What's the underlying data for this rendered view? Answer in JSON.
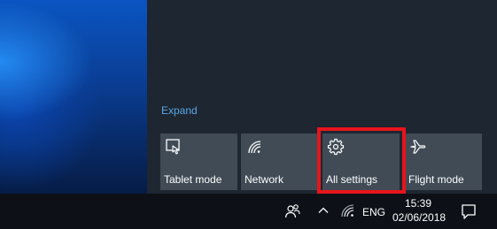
{
  "action_center": {
    "expand_label": "Expand",
    "tiles": [
      {
        "label": "Tablet mode",
        "icon": "tablet-mode-icon"
      },
      {
        "label": "Network",
        "icon": "network-icon"
      },
      {
        "label": "All settings",
        "icon": "gear-icon"
      },
      {
        "label": "Flight mode",
        "icon": "airplane-icon"
      }
    ],
    "highlight_color": "#e8141c"
  },
  "taskbar": {
    "language": "ENG",
    "time": "15:39",
    "date": "02/06/2018",
    "icons": [
      "people-icon",
      "chevron-up-icon",
      "wifi-icon",
      "notification-icon"
    ]
  },
  "colors": {
    "tile_bg": "#404b55",
    "panel_bg": "#1d2631",
    "taskbar_bg": "#0d1117",
    "accent_link": "#5aa7e6"
  }
}
